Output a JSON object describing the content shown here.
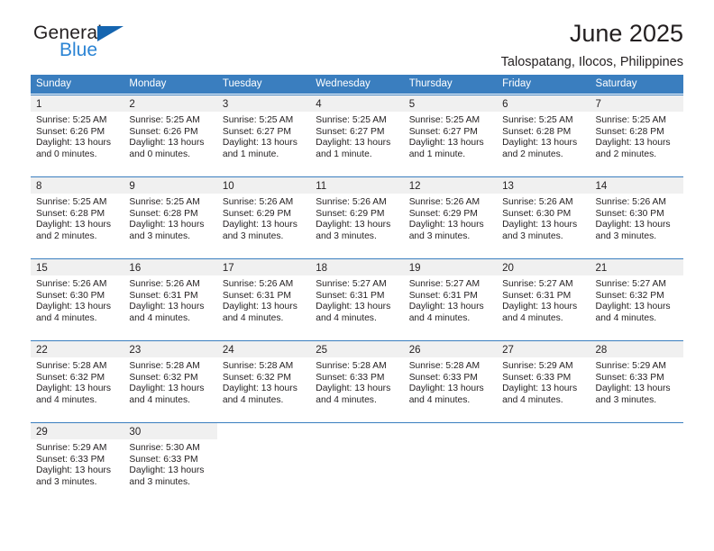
{
  "brand": {
    "line1": "General",
    "line2": "Blue",
    "triangle_color": "#1565b0",
    "line2_color": "#2b84d4"
  },
  "header": {
    "title": "June 2025",
    "subtitle": "Talospatang, Ilocos, Philippines"
  },
  "theme": {
    "header_blue": "#3a7ebf",
    "daynum_band": "#f0f0f0",
    "text": "#231f20"
  },
  "weekdays": [
    "Sunday",
    "Monday",
    "Tuesday",
    "Wednesday",
    "Thursday",
    "Friday",
    "Saturday"
  ],
  "weeks": [
    [
      {
        "day": "1",
        "sunrise": "Sunrise: 5:25 AM",
        "sunset": "Sunset: 6:26 PM",
        "daylight1": "Daylight: 13 hours",
        "daylight2": "and 0 minutes."
      },
      {
        "day": "2",
        "sunrise": "Sunrise: 5:25 AM",
        "sunset": "Sunset: 6:26 PM",
        "daylight1": "Daylight: 13 hours",
        "daylight2": "and 0 minutes."
      },
      {
        "day": "3",
        "sunrise": "Sunrise: 5:25 AM",
        "sunset": "Sunset: 6:27 PM",
        "daylight1": "Daylight: 13 hours",
        "daylight2": "and 1 minute."
      },
      {
        "day": "4",
        "sunrise": "Sunrise: 5:25 AM",
        "sunset": "Sunset: 6:27 PM",
        "daylight1": "Daylight: 13 hours",
        "daylight2": "and 1 minute."
      },
      {
        "day": "5",
        "sunrise": "Sunrise: 5:25 AM",
        "sunset": "Sunset: 6:27 PM",
        "daylight1": "Daylight: 13 hours",
        "daylight2": "and 1 minute."
      },
      {
        "day": "6",
        "sunrise": "Sunrise: 5:25 AM",
        "sunset": "Sunset: 6:28 PM",
        "daylight1": "Daylight: 13 hours",
        "daylight2": "and 2 minutes."
      },
      {
        "day": "7",
        "sunrise": "Sunrise: 5:25 AM",
        "sunset": "Sunset: 6:28 PM",
        "daylight1": "Daylight: 13 hours",
        "daylight2": "and 2 minutes."
      }
    ],
    [
      {
        "day": "8",
        "sunrise": "Sunrise: 5:25 AM",
        "sunset": "Sunset: 6:28 PM",
        "daylight1": "Daylight: 13 hours",
        "daylight2": "and 2 minutes."
      },
      {
        "day": "9",
        "sunrise": "Sunrise: 5:25 AM",
        "sunset": "Sunset: 6:28 PM",
        "daylight1": "Daylight: 13 hours",
        "daylight2": "and 3 minutes."
      },
      {
        "day": "10",
        "sunrise": "Sunrise: 5:26 AM",
        "sunset": "Sunset: 6:29 PM",
        "daylight1": "Daylight: 13 hours",
        "daylight2": "and 3 minutes."
      },
      {
        "day": "11",
        "sunrise": "Sunrise: 5:26 AM",
        "sunset": "Sunset: 6:29 PM",
        "daylight1": "Daylight: 13 hours",
        "daylight2": "and 3 minutes."
      },
      {
        "day": "12",
        "sunrise": "Sunrise: 5:26 AM",
        "sunset": "Sunset: 6:29 PM",
        "daylight1": "Daylight: 13 hours",
        "daylight2": "and 3 minutes."
      },
      {
        "day": "13",
        "sunrise": "Sunrise: 5:26 AM",
        "sunset": "Sunset: 6:30 PM",
        "daylight1": "Daylight: 13 hours",
        "daylight2": "and 3 minutes."
      },
      {
        "day": "14",
        "sunrise": "Sunrise: 5:26 AM",
        "sunset": "Sunset: 6:30 PM",
        "daylight1": "Daylight: 13 hours",
        "daylight2": "and 3 minutes."
      }
    ],
    [
      {
        "day": "15",
        "sunrise": "Sunrise: 5:26 AM",
        "sunset": "Sunset: 6:30 PM",
        "daylight1": "Daylight: 13 hours",
        "daylight2": "and 4 minutes."
      },
      {
        "day": "16",
        "sunrise": "Sunrise: 5:26 AM",
        "sunset": "Sunset: 6:31 PM",
        "daylight1": "Daylight: 13 hours",
        "daylight2": "and 4 minutes."
      },
      {
        "day": "17",
        "sunrise": "Sunrise: 5:26 AM",
        "sunset": "Sunset: 6:31 PM",
        "daylight1": "Daylight: 13 hours",
        "daylight2": "and 4 minutes."
      },
      {
        "day": "18",
        "sunrise": "Sunrise: 5:27 AM",
        "sunset": "Sunset: 6:31 PM",
        "daylight1": "Daylight: 13 hours",
        "daylight2": "and 4 minutes."
      },
      {
        "day": "19",
        "sunrise": "Sunrise: 5:27 AM",
        "sunset": "Sunset: 6:31 PM",
        "daylight1": "Daylight: 13 hours",
        "daylight2": "and 4 minutes."
      },
      {
        "day": "20",
        "sunrise": "Sunrise: 5:27 AM",
        "sunset": "Sunset: 6:31 PM",
        "daylight1": "Daylight: 13 hours",
        "daylight2": "and 4 minutes."
      },
      {
        "day": "21",
        "sunrise": "Sunrise: 5:27 AM",
        "sunset": "Sunset: 6:32 PM",
        "daylight1": "Daylight: 13 hours",
        "daylight2": "and 4 minutes."
      }
    ],
    [
      {
        "day": "22",
        "sunrise": "Sunrise: 5:28 AM",
        "sunset": "Sunset: 6:32 PM",
        "daylight1": "Daylight: 13 hours",
        "daylight2": "and 4 minutes."
      },
      {
        "day": "23",
        "sunrise": "Sunrise: 5:28 AM",
        "sunset": "Sunset: 6:32 PM",
        "daylight1": "Daylight: 13 hours",
        "daylight2": "and 4 minutes."
      },
      {
        "day": "24",
        "sunrise": "Sunrise: 5:28 AM",
        "sunset": "Sunset: 6:32 PM",
        "daylight1": "Daylight: 13 hours",
        "daylight2": "and 4 minutes."
      },
      {
        "day": "25",
        "sunrise": "Sunrise: 5:28 AM",
        "sunset": "Sunset: 6:33 PM",
        "daylight1": "Daylight: 13 hours",
        "daylight2": "and 4 minutes."
      },
      {
        "day": "26",
        "sunrise": "Sunrise: 5:28 AM",
        "sunset": "Sunset: 6:33 PM",
        "daylight1": "Daylight: 13 hours",
        "daylight2": "and 4 minutes."
      },
      {
        "day": "27",
        "sunrise": "Sunrise: 5:29 AM",
        "sunset": "Sunset: 6:33 PM",
        "daylight1": "Daylight: 13 hours",
        "daylight2": "and 4 minutes."
      },
      {
        "day": "28",
        "sunrise": "Sunrise: 5:29 AM",
        "sunset": "Sunset: 6:33 PM",
        "daylight1": "Daylight: 13 hours",
        "daylight2": "and 3 minutes."
      }
    ],
    [
      {
        "day": "29",
        "sunrise": "Sunrise: 5:29 AM",
        "sunset": "Sunset: 6:33 PM",
        "daylight1": "Daylight: 13 hours",
        "daylight2": "and 3 minutes."
      },
      {
        "day": "30",
        "sunrise": "Sunrise: 5:30 AM",
        "sunset": "Sunset: 6:33 PM",
        "daylight1": "Daylight: 13 hours",
        "daylight2": "and 3 minutes."
      },
      {
        "day": "",
        "sunrise": "",
        "sunset": "",
        "daylight1": "",
        "daylight2": ""
      },
      {
        "day": "",
        "sunrise": "",
        "sunset": "",
        "daylight1": "",
        "daylight2": ""
      },
      {
        "day": "",
        "sunrise": "",
        "sunset": "",
        "daylight1": "",
        "daylight2": ""
      },
      {
        "day": "",
        "sunrise": "",
        "sunset": "",
        "daylight1": "",
        "daylight2": ""
      },
      {
        "day": "",
        "sunrise": "",
        "sunset": "",
        "daylight1": "",
        "daylight2": ""
      }
    ]
  ]
}
